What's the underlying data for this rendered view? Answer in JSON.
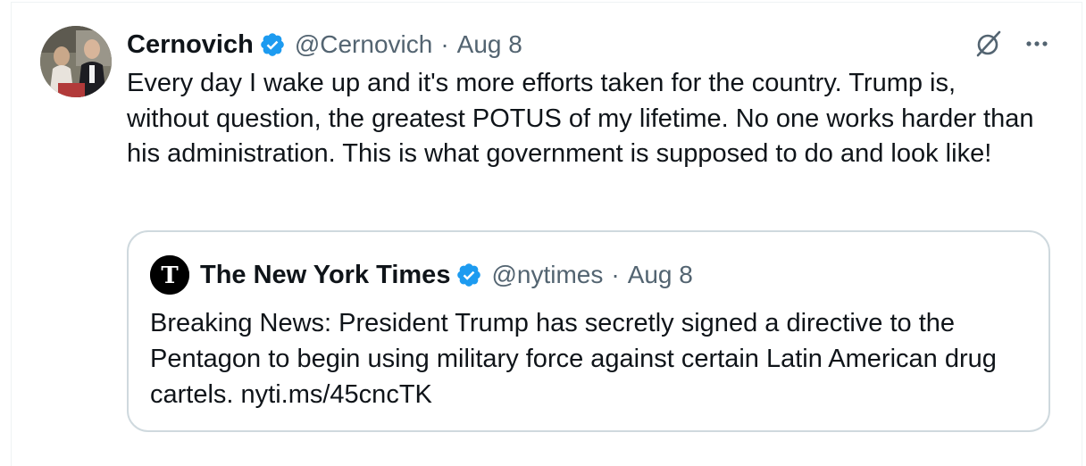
{
  "tweet": {
    "author_name": "Cernovich",
    "handle": "@Cernovich",
    "separator": "·",
    "date": "Aug 8",
    "text": "Every day I wake up and it's more efforts taken for the country. Trump is, without question, the greatest POTUS of my lifetime. No one works harder than his administration. This is what government is supposed to do and look like!",
    "icons": [
      "grok-icon",
      "more-icon",
      "verified-badge-icon"
    ]
  },
  "quote": {
    "author_name": "The New York Times",
    "handle": "@nytimes",
    "separator": "·",
    "date": "Aug 8",
    "text": "Breaking News: President Trump has secretly signed a directive to the Pentagon to begin using military force against certain Latin American drug cartels. nyti.ms/45cncTK"
  },
  "colors": {
    "verified_blue": "#1d9bf0",
    "secondary_text": "#536471",
    "border": "#cfd9de",
    "primary_text": "#0f1419"
  }
}
